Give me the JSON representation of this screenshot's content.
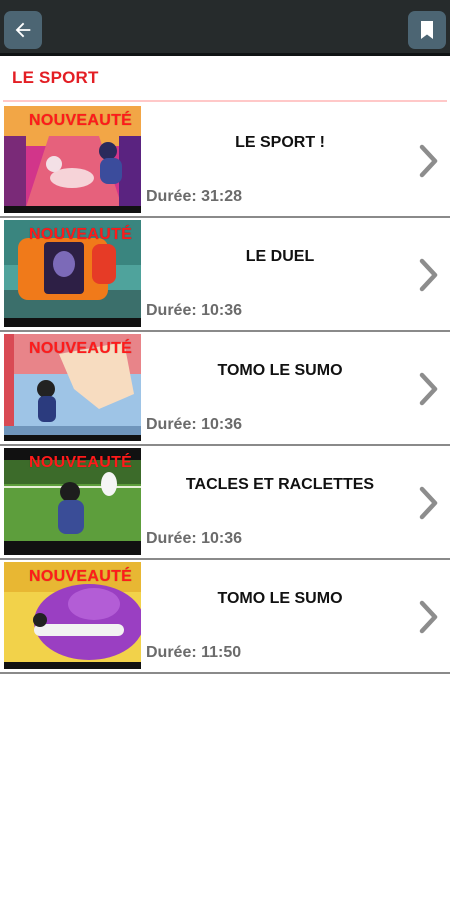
{
  "header": {
    "back_icon": "arrow-left-icon",
    "bookmark_icon": "bookmark-icon",
    "background": "#262b2c",
    "button_color": "#4c6573"
  },
  "section": {
    "title": "LE SPORT",
    "color": "#e31e24"
  },
  "episodes": [
    {
      "badge": "NOUVEAUTÉ",
      "title": "LE SPORT !",
      "duration": "Durée: 31:28"
    },
    {
      "badge": "NOUVEAUTÉ",
      "title": "LE DUEL",
      "duration": "Durée: 10:36"
    },
    {
      "badge": "NOUVEAUTÉ",
      "title": "TOMO LE SUMO",
      "duration": "Durée: 10:36"
    },
    {
      "badge": "NOUVEAUTÉ",
      "title": "TACLES ET RACLETTES",
      "duration": "Durée: 10:36"
    },
    {
      "badge": "NOUVEAUTÉ",
      "title": "TOMO LE SUMO",
      "duration": "Durée: 11:50"
    }
  ]
}
